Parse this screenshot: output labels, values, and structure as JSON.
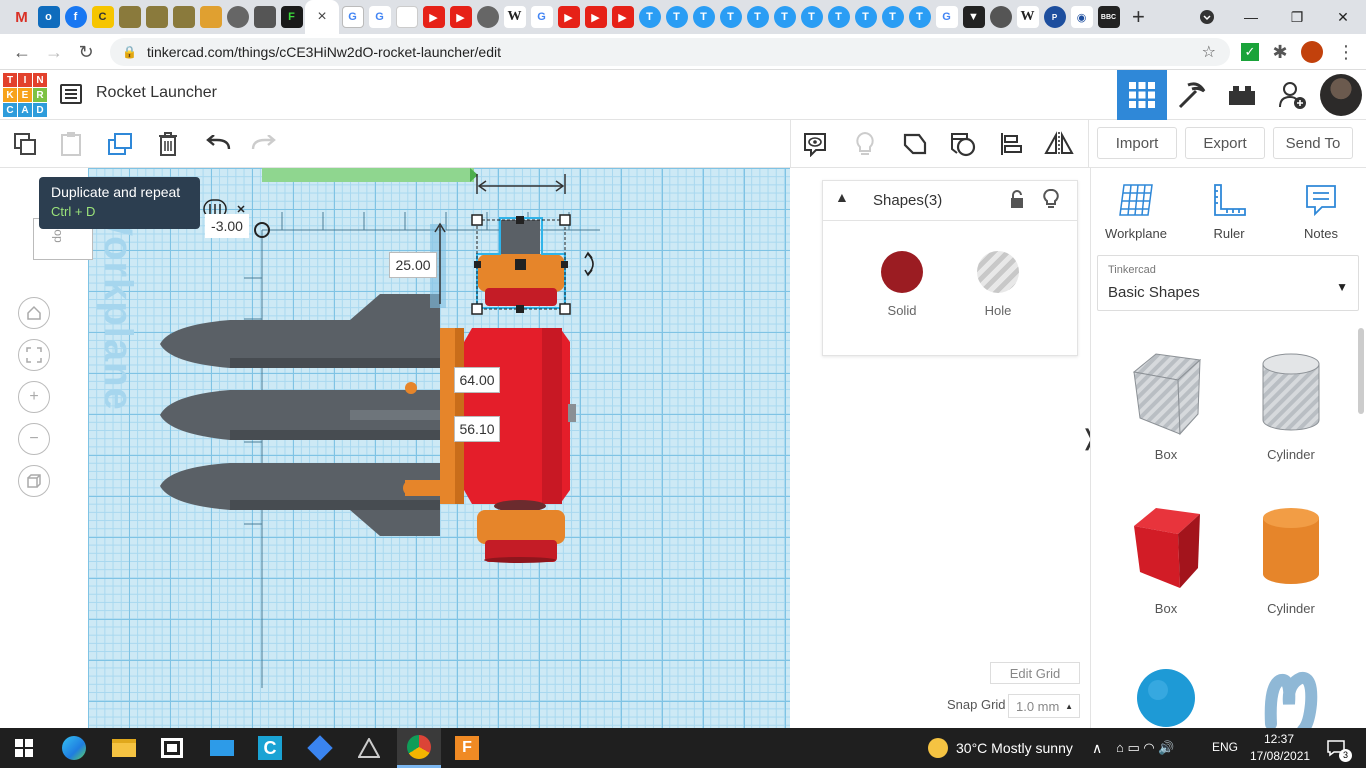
{
  "browser": {
    "url": "tinkercad.com/things/cCE3HiNw2dO-rocket-launcher/edit",
    "tab_close": "×",
    "new_tab": "+"
  },
  "app": {
    "logo_letters": [
      "T",
      "I",
      "N",
      "K",
      "E",
      "R",
      "C",
      "A",
      "D"
    ],
    "title": "Rocket Launcher"
  },
  "toolbar": {
    "import_label": "Import",
    "export_label": "Export",
    "send_to_label": "Send To"
  },
  "tooltip": {
    "title": "Duplicate and repeat",
    "shortcut": "Ctrl + D"
  },
  "viewport": {
    "viewcube_label": "op",
    "workplane_label": "Workplane",
    "dim_x": "-3.00",
    "dim_height": "25.00",
    "dim_length": "64.00",
    "dim_width": "56.10"
  },
  "shapes_panel": {
    "title": "Shapes(3)",
    "solid_label": "Solid",
    "hole_label": "Hole",
    "solid_color": "#9b1c22"
  },
  "grid_controls": {
    "edit_grid": "Edit Grid",
    "snap_label": "Snap Grid",
    "snap_value": "1.0 mm"
  },
  "library": {
    "tools": [
      "Workplane",
      "Ruler",
      "Notes"
    ],
    "category_small": "Tinkercad",
    "category": "Basic Shapes",
    "shapes": [
      {
        "label": "Box",
        "kind": "hole-box"
      },
      {
        "label": "Cylinder",
        "kind": "hole-cylinder"
      },
      {
        "label": "Box",
        "kind": "red-box"
      },
      {
        "label": "Cylinder",
        "kind": "orange-cylinder"
      }
    ]
  },
  "taskbar": {
    "weather": "30°C  Mostly sunny",
    "lang": "ENG",
    "time": "12:37",
    "date": "17/08/2021",
    "notifications": "3"
  }
}
